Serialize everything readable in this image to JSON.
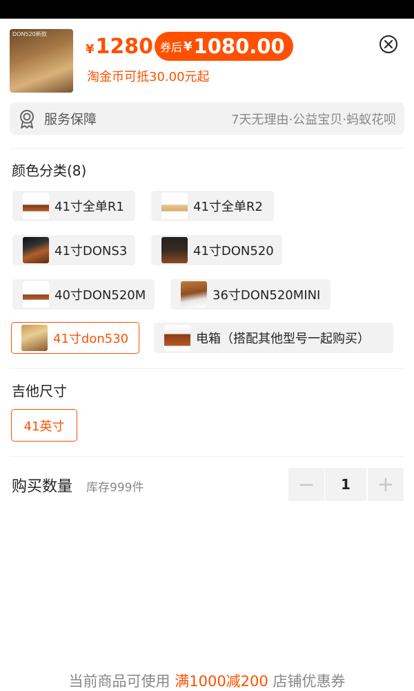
{
  "product": {
    "thumb_caption": "DON520新款",
    "price_currency": "¥",
    "price": "1280",
    "coupon_label": "券后",
    "coupon_currency": "¥",
    "coupon_price": "1080.00",
    "coin_note": "淘金币可抵30.00元起"
  },
  "service": {
    "title": "服务保障",
    "desc": "7天无理由·公益宝贝·蚂蚁花呗"
  },
  "color_section": {
    "title": "颜色分类(8)",
    "options": [
      {
        "label": "41寸全单R1",
        "thumb": "t1",
        "selected": false
      },
      {
        "label": "41寸全单R2",
        "thumb": "t2",
        "selected": false
      },
      {
        "label": "41寸DONS3",
        "thumb": "t3",
        "selected": false
      },
      {
        "label": "41寸DON520",
        "thumb": "t4",
        "selected": false
      },
      {
        "label": "40寸DON520M",
        "thumb": "t5",
        "selected": false
      },
      {
        "label": "36寸DON520MINI",
        "thumb": "t6",
        "selected": false
      },
      {
        "label": "41寸don530",
        "thumb": "t7",
        "selected": true
      },
      {
        "label": "电箱（搭配其他型号一起购买）",
        "thumb": "t8",
        "selected": false
      }
    ]
  },
  "size_section": {
    "title": "吉他尺寸",
    "options": [
      {
        "label": "41英寸",
        "selected": true
      }
    ]
  },
  "quantity": {
    "label": "购买数量",
    "stock": "库存999件",
    "minus": "−",
    "value": "1",
    "plus": "+"
  },
  "footer": {
    "prefix": "当前商品可使用",
    "highlight": "满1000减200",
    "suffix": "店铺优惠券"
  },
  "colors": {
    "accent": "#ff5000",
    "chip_bg": "#f2f2f2"
  }
}
